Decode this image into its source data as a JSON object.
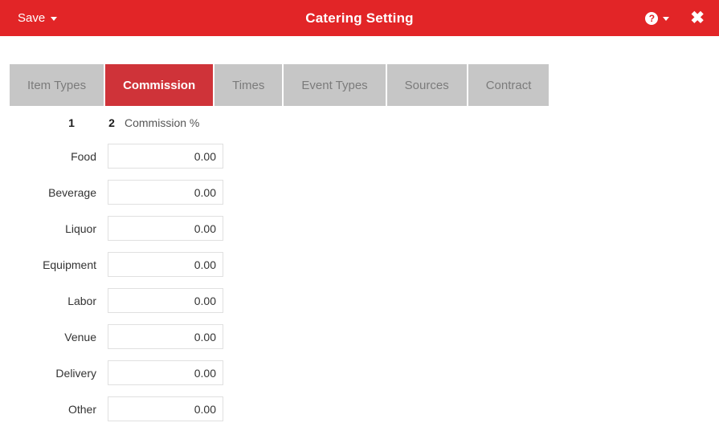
{
  "topbar": {
    "save_label": "Save",
    "save_caret_icon": "caret-down-icon",
    "title": "Catering Setting",
    "help_icon": "question-mark-icon",
    "help_glyph": "?",
    "help_caret_icon": "caret-down-icon",
    "close_icon": "close-x-icon",
    "close_glyph": "✖",
    "background_color": "#e22527",
    "text_color": "#ffffff"
  },
  "tabs": [
    {
      "label": "Item Types",
      "active": false
    },
    {
      "label": "Commission",
      "active": true
    },
    {
      "label": "Times",
      "active": false
    },
    {
      "label": "Event Types",
      "active": false
    },
    {
      "label": "Sources",
      "active": false
    },
    {
      "label": "Contract",
      "active": false
    }
  ],
  "tab_colors": {
    "inactive_bg": "#c6c6c6",
    "inactive_text": "#7b7b7b",
    "active_bg": "#cf3339",
    "active_text": "#ffffff"
  },
  "form": {
    "column_headers": {
      "num_1": "1",
      "num_2": "2",
      "commission_label": "Commission %"
    },
    "rows": [
      {
        "label": "Food",
        "value": "0.00"
      },
      {
        "label": "Beverage",
        "value": "0.00"
      },
      {
        "label": "Liquor",
        "value": "0.00"
      },
      {
        "label": "Equipment",
        "value": "0.00"
      },
      {
        "label": "Labor",
        "value": "0.00"
      },
      {
        "label": "Venue",
        "value": "0.00"
      },
      {
        "label": "Delivery",
        "value": "0.00"
      },
      {
        "label": "Other",
        "value": "0.00"
      }
    ]
  }
}
